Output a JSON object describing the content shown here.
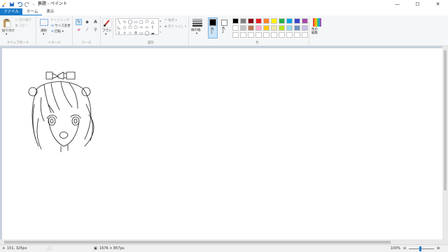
{
  "title": "無題 - ペイント",
  "tabs": [
    "ファイル",
    "ホーム",
    "表示"
  ],
  "clipboard": {
    "paste": "貼り付け",
    "cut": "切り取り",
    "copy": "コピー",
    "group": "クリップボード"
  },
  "image": {
    "select": "選択",
    "crop": "トリミング",
    "resize": "サイズ変更",
    "rotate": "回転",
    "group": "イメージ"
  },
  "tools": {
    "group": "ツール",
    "brushes": "ブラシ"
  },
  "shapes": {
    "outline": "輪郭",
    "fill": "塗りつぶし",
    "group": "図形"
  },
  "size": {
    "label": "線の幅"
  },
  "colors": {
    "color1": "色\n1",
    "color2": "色\n2",
    "edit": "色の\n編集",
    "group": "色",
    "palette": [
      "#000000",
      "#7f7f7f",
      "#880015",
      "#ed1c24",
      "#ff7f27",
      "#fff200",
      "#22b14c",
      "#00a2e8",
      "#3f48cc",
      "#a349a4",
      "#ffffff",
      "#c3c3c3",
      "#b97a57",
      "#ffaec9",
      "#ffc90e",
      "#efe4b0",
      "#b5e61d",
      "#99d9ea",
      "#7092be",
      "#c8bfe7",
      "#ffffff",
      "#ffffff",
      "#ffffff",
      "#ffffff",
      "#ffffff",
      "#ffffff",
      "#ffffff",
      "#ffffff",
      "#ffffff",
      "#ffffff"
    ],
    "color1_value": "#000000",
    "color2_value": "#ffffff"
  },
  "status": {
    "cursor": "151, 325px",
    "canvas_size": "1676 × 857px",
    "zoom": "100%"
  }
}
